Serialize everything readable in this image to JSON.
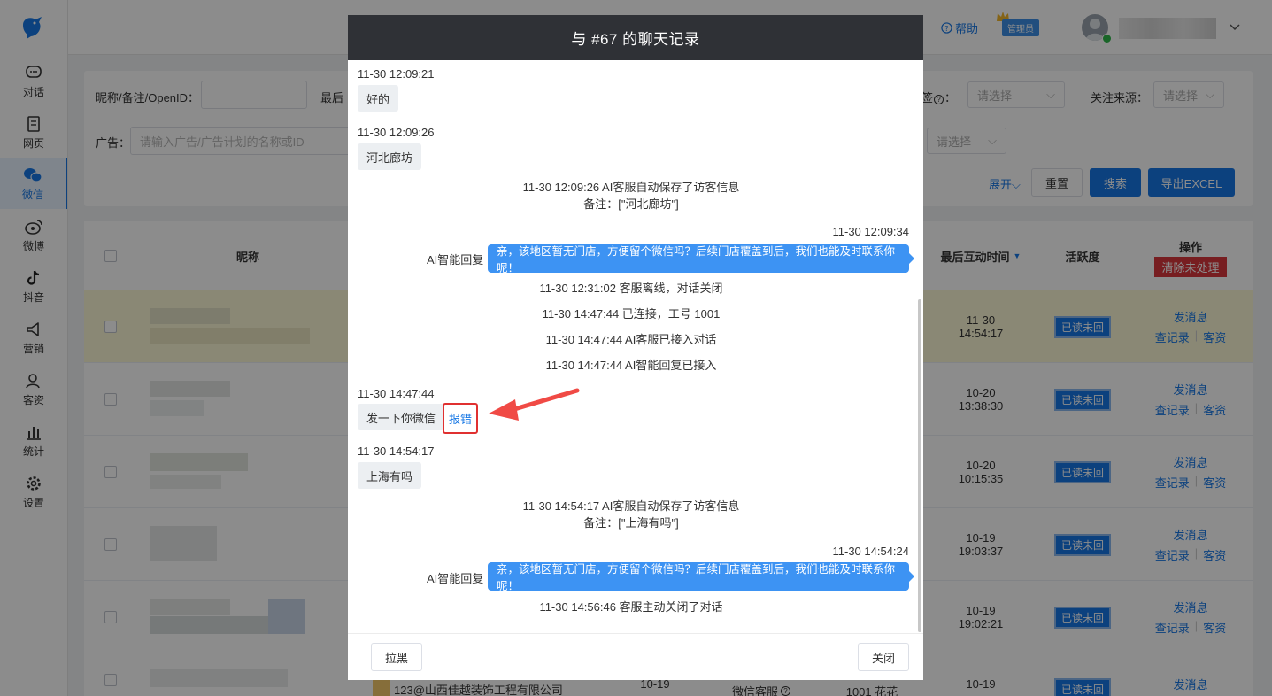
{
  "sidebar": {
    "items": [
      {
        "label": "对话",
        "icon": "chat-bubble-icon"
      },
      {
        "label": "网页",
        "icon": "document-icon"
      },
      {
        "label": "微信",
        "icon": "wechat-icon",
        "active": true
      },
      {
        "label": "微博",
        "icon": "weibo-icon"
      },
      {
        "label": "抖音",
        "icon": "douyin-icon"
      },
      {
        "label": "营销",
        "icon": "megaphone-icon"
      },
      {
        "label": "客资",
        "icon": "person-icon"
      },
      {
        "label": "统计",
        "icon": "bar-chart-icon"
      },
      {
        "label": "设置",
        "icon": "gear-icon"
      }
    ]
  },
  "topbar": {
    "help": "帮助",
    "admin_badge": "管理员"
  },
  "filters": {
    "nickname_label": "昵称/备注/OpenID：",
    "last_label": "最后",
    "tag_label": "签",
    "tag_suffix": "：",
    "tag_placeholder": "请选择",
    "source_label": "关注来源：",
    "source_placeholder": "请选择",
    "ad_label": "广告：",
    "ad_placeholder": "请输入广告/广告计划的名称或ID",
    "ad_select_placeholder": "请选择",
    "expand": "展开",
    "reset": "重置",
    "search": "搜索",
    "export": "导出EXCEL"
  },
  "table": {
    "headers": {
      "nickname": "昵称",
      "last_time": "最后互动时间",
      "activity": "活跃度",
      "ops": "操作",
      "clear": "清除未处理"
    },
    "rows": [
      {
        "time1": "11-30",
        "time2": "14:54:17",
        "status": "已读未回",
        "send": "发消息",
        "record": "查记录",
        "lead": "客资"
      },
      {
        "time1": "10-20",
        "time2": "13:38:30",
        "status": "已读未回",
        "send": "发消息",
        "record": "查记录",
        "lead": "客资"
      },
      {
        "time1": "10-20",
        "time2": "10:15:35",
        "status": "已读未回",
        "send": "发消息",
        "record": "查记录",
        "lead": "客资"
      },
      {
        "time1": "10-19",
        "time2": "19:03:37",
        "status": "已读未回",
        "send": "发消息",
        "record": "查记录",
        "lead": "客资"
      },
      {
        "time1": "10-19",
        "time2": "19:02:21",
        "status": "已读未回",
        "send": "发消息",
        "record": "查记录",
        "lead": "客资"
      }
    ],
    "partial_row": {
      "company": "123@山西佳越装饰工程有限公司",
      "date": "10-19",
      "service": "微信客服",
      "agent": "1001 花花",
      "time1": "10-19",
      "status": "已读未回",
      "send": "发消息"
    }
  },
  "modal": {
    "title": "与 #67 的聊天记录",
    "messages": {
      "m1_ts": "11-30 12:09:21",
      "m1_text": "好的",
      "m2_ts": "11-30 12:09:26",
      "m2_text": "河北廊坊",
      "sys1_l1": "11-30 12:09:26 AI客服自动保存了访客信息",
      "sys1_l2": "备注：[\"河北廊坊\"]",
      "out1_ts": "11-30 12:09:34",
      "out1_sender": "AI智能回复",
      "out1_text": "亲，该地区暂无门店，方便留个微信吗？后续门店覆盖到后，我们也能及时联系你呢！",
      "sys2": "11-30 12:31:02 客服离线，对话关闭",
      "sys3": "11-30 14:47:44 已连接，工号 1001",
      "sys4": "11-30 14:47:44 AI客服已接入对话",
      "sys5": "11-30 14:47:44 AI智能回复已接入",
      "m3_ts": "11-30 14:47:44",
      "m3_text": "发一下你微信",
      "m3_report": "报错",
      "m4_ts": "11-30 14:54:17",
      "m4_text": "上海有吗",
      "sys6_l1": "11-30 14:54:17 AI客服自动保存了访客信息",
      "sys6_l2": "备注：[\"上海有吗\"]",
      "out2_ts": "11-30 14:54:24",
      "out2_sender": "AI智能回复",
      "out2_text": "亲，该地区暂无门店，方便留个微信吗？后续门店覆盖到后，我们也能及时联系你呢！",
      "sys7": "11-30 14:56:46 客服主动关闭了对话"
    },
    "blacklist": "拉黑",
    "close": "关闭"
  },
  "colors": {
    "primary": "#1677e5",
    "modal_header": "#2f3136",
    "bubble_out": "#3d93f3",
    "danger": "#d9373d",
    "annotation_red": "#e03030"
  }
}
